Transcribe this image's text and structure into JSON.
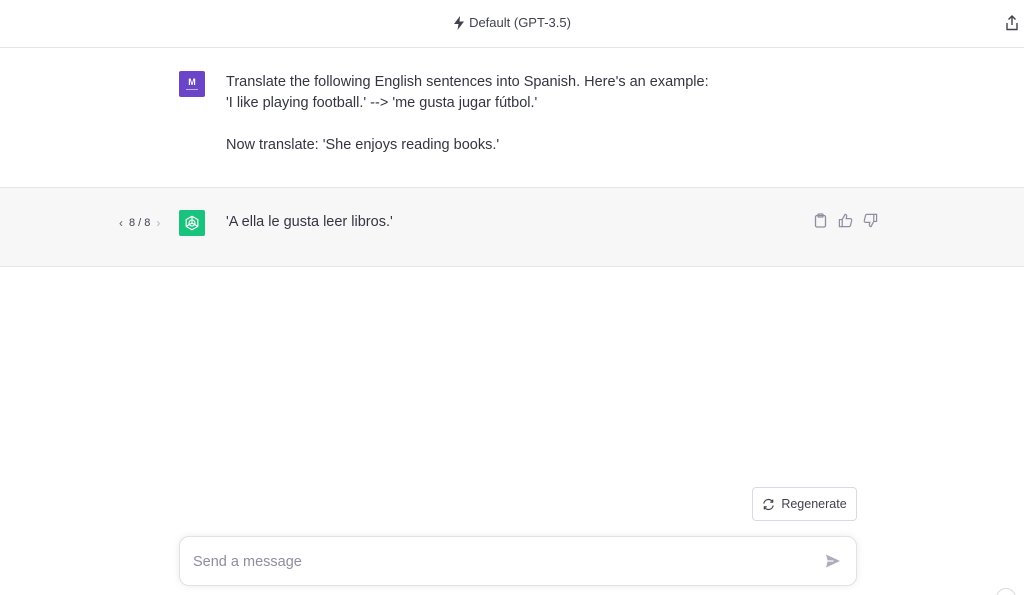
{
  "header": {
    "model_label": "Default (GPT-3.5)"
  },
  "conversation": {
    "user_message": {
      "avatar_text": "M",
      "lines": [
        "Translate the following English sentences into Spanish. Here's an example:",
        "'I like playing football.' --> 'me gusta jugar fútbol.'",
        "",
        "Now translate: 'She enjoys reading books.'"
      ]
    },
    "assistant_message": {
      "pager_text": "8 / 8",
      "text": "'A ella le gusta leer libros.'"
    }
  },
  "regenerate_label": "Regenerate",
  "composer": {
    "placeholder": "Send a message"
  },
  "colors": {
    "user_avatar": "#6a45c8",
    "assistant_avatar": "#19c37d",
    "assistant_bg": "#f7f7f8"
  },
  "icons": {
    "model": "bolt-icon",
    "share": "share-icon",
    "copy": "clipboard-icon",
    "like": "thumbs-up-icon",
    "dislike": "thumbs-down-icon",
    "regenerate": "refresh-icon",
    "send": "send-icon"
  }
}
